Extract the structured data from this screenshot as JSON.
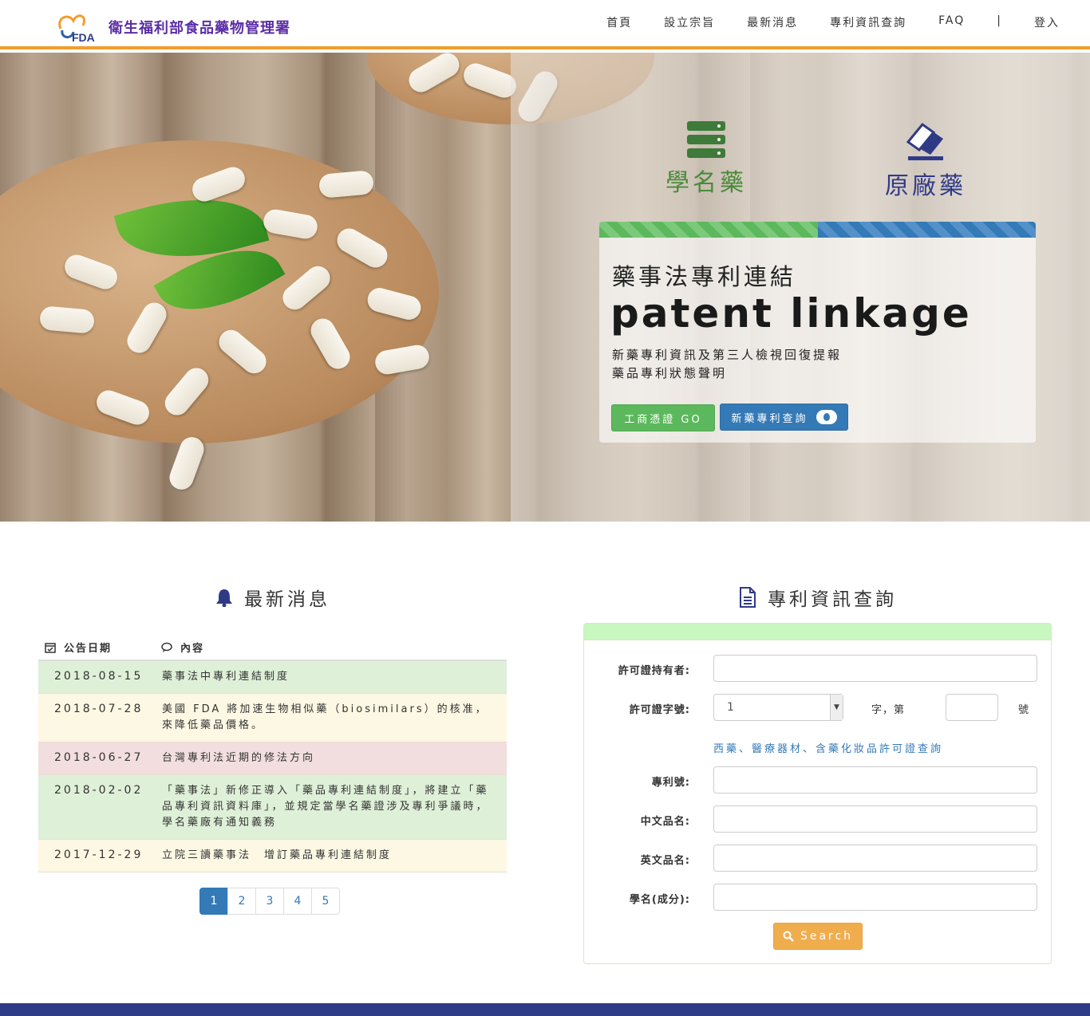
{
  "brand": {
    "logo_text": "FDA",
    "title": "衛生福利部食品藥物管理署"
  },
  "nav": {
    "items": [
      "首頁",
      "設立宗旨",
      "最新消息",
      "專利資訊查詢",
      "FAQ",
      "|",
      "登入"
    ]
  },
  "hero": {
    "generic_label": "學名藥",
    "brand_label": "原廠藥",
    "progress": {
      "generic_fraction": 0.5,
      "brand_fraction": 0.5
    },
    "subtitle": "藥事法專利連結",
    "title": "patent linkage",
    "desc_line1": "新藥專利資訊及第三人檢視回復提報",
    "desc_line2": "藥品專利狀態聲明",
    "btn_go": "工商憑證 GO",
    "btn_query": "新藥專利查詢"
  },
  "news": {
    "title": "最新消息",
    "col_date": "公告日期",
    "col_content": "內容",
    "rows": [
      {
        "date": "2018-08-15",
        "text": "藥事法中專利連結制度"
      },
      {
        "date": "2018-07-28",
        "text": "美國 FDA 將加速生物相似藥（biosimilars）的核准，來降低藥品價格。"
      },
      {
        "date": "2018-06-27",
        "text": "台灣專利法近期的修法方向"
      },
      {
        "date": "2018-02-02",
        "text": "「藥事法」新修正導入「藥品專利連結制度」，將建立「藥品專利資訊資料庫」，並規定當學名藥證涉及專利爭議時，學名藥廠有通知義務"
      },
      {
        "date": "2017-12-29",
        "text": "立院三讀藥事法　增訂藥品專利連結制度"
      }
    ],
    "pages": [
      "1",
      "2",
      "3",
      "4",
      "5"
    ]
  },
  "patent": {
    "title": "專利資訊查詢",
    "label_holder": "許可證持有者:",
    "label_license": "許可證字號:",
    "license_select": "1",
    "word_zi": "字，第",
    "word_hao": "號",
    "link_text": "西藥、醫療器材、含藥化妝品許可證查詢",
    "label_patent_no": "專利號:",
    "label_cn_name": "中文品名:",
    "label_en_name": "英文品名:",
    "label_generic": "學名(成分):",
    "search_btn": "Search"
  },
  "colors": {
    "accent_orange": "#f39c2b",
    "brand_purple": "#5b2ea6",
    "footer": "#2e3b87",
    "green": "#5cb85c",
    "blue": "#337ab7"
  }
}
